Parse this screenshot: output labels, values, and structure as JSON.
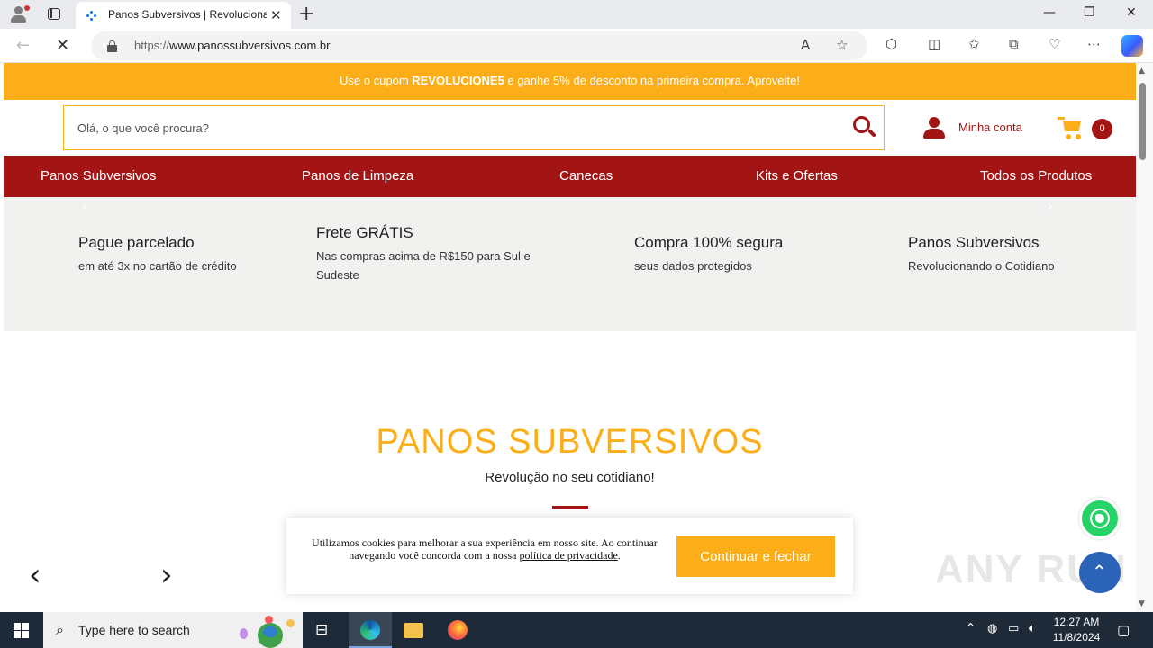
{
  "browser": {
    "tab_title": "Panos Subversivos | Revolucionan",
    "tab_close": "✕",
    "new_tab": "+",
    "url_proto": "https://",
    "url_host": "www.panossubversivos.com.br",
    "window_min": "—",
    "window_restore": "❐",
    "window_close": "✕",
    "icons": [
      "back-icon",
      "reload-stop-icon",
      "read-aloud-icon",
      "favorite-icon",
      "extensions-icon",
      "split-screen-icon",
      "favorites-icon",
      "collections-icon",
      "browser-essentials-icon",
      "more-icon",
      "copilot-icon"
    ]
  },
  "promo": {
    "before": "Use o cupom ",
    "code": "REVOLUCIONE5",
    "after": " e ganhe 5% de desconto na primeira compra. Aproveite!"
  },
  "header": {
    "search_placeholder": "Olá, o que você procura?",
    "account_label": "Minha conta",
    "cart_count": "0"
  },
  "nav": {
    "items": [
      "Panos Subversivos",
      "Panos de Limpeza",
      "Canecas",
      "Kits e Ofertas",
      "Todos os Produtos"
    ]
  },
  "benefits": {
    "prev": "‹",
    "next": "›",
    "items": [
      {
        "title": "Pague parcelado",
        "subtitle": "em até 3x no cartão de crédito"
      },
      {
        "title": "Frete GRÁTIS",
        "subtitle": "Nas compras acima de R$150 para Sul e Sudeste"
      },
      {
        "title": "Compra 100% segura",
        "subtitle": "seus dados protegidos"
      },
      {
        "title": "Panos Subversivos",
        "subtitle": "Revolucionando o Cotidiano"
      }
    ]
  },
  "section": {
    "title": "PANOS SUBVERSIVOS",
    "subtitle": "Revolução no seu cotidiano!",
    "prev": "‹",
    "next": "›"
  },
  "cookie": {
    "text": "Utilizamos cookies para melhorar a sua experiência em nosso site. Ao continuar navegando você concorda com a nossa ",
    "link": "política de privacidade",
    "end": ".",
    "button": "Continuar e fechar"
  },
  "watermark": "ANY RUN",
  "taskbar": {
    "search_placeholder": "Type here to search",
    "time": "12:27 AM",
    "date": "11/8/2024"
  },
  "colors": {
    "brand_orange": "#fbae17",
    "brand_red": "#a31515"
  }
}
